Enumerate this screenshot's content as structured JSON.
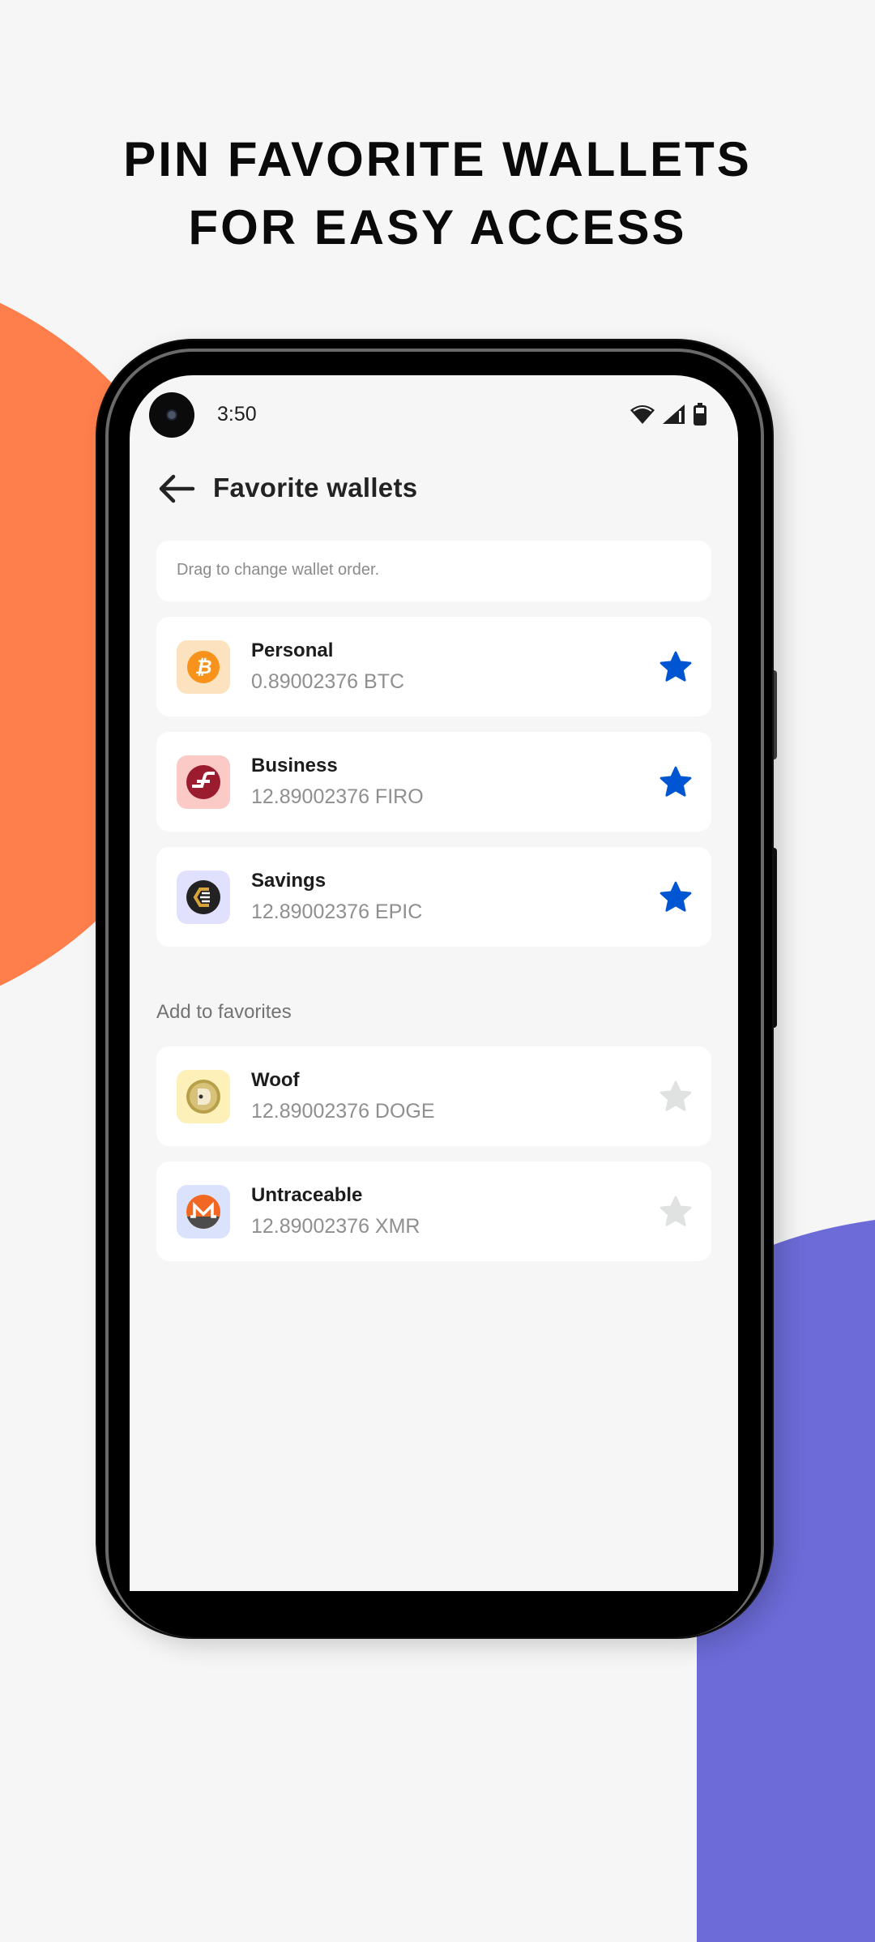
{
  "headline": {
    "line1": "PIN FAVORITE WALLETS",
    "line2": "FOR EASY ACCESS"
  },
  "colors": {
    "accent_blob": "#fe7e4c",
    "secondary_blob": "#6c6bd8",
    "star_active": "#0056d2",
    "star_inactive": "#e0e2e2"
  },
  "status_bar": {
    "time": "3:50",
    "icons": [
      "wifi-icon",
      "signal-icon",
      "battery-icon"
    ]
  },
  "app_bar": {
    "back_icon": "arrow-left-icon",
    "title": "Favorite wallets"
  },
  "hint": {
    "text": "Drag to change wallet order."
  },
  "favorites": [
    {
      "name": "Personal",
      "amount": "0.89002376 BTC",
      "coin": "bitcoin",
      "favorite": true
    },
    {
      "name": "Business",
      "amount": "12.89002376 FIRO",
      "coin": "firo",
      "favorite": true
    },
    {
      "name": "Savings",
      "amount": "12.89002376 EPIC",
      "coin": "epic-cash",
      "favorite": true
    }
  ],
  "add_section": {
    "label": "Add to favorites"
  },
  "others": [
    {
      "name": "Woof",
      "amount": "12.89002376 DOGE",
      "coin": "dogecoin",
      "favorite": false
    },
    {
      "name": "Untraceable",
      "amount": "12.89002376 XMR",
      "coin": "monero",
      "favorite": false
    }
  ]
}
